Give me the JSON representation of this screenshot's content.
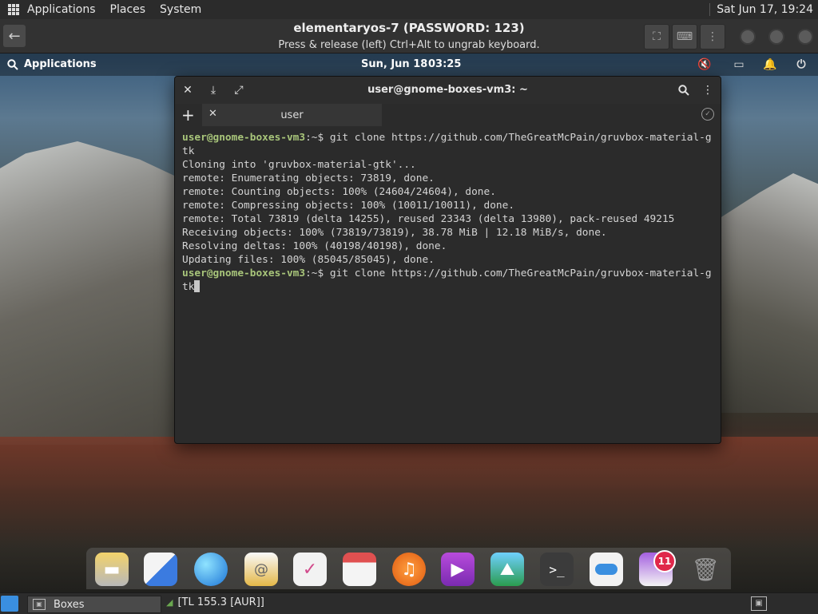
{
  "host": {
    "menu": [
      "Applications",
      "Places",
      "System"
    ],
    "clock": "Sat Jun 17, 19:24"
  },
  "boxes": {
    "title": "elementaryos-7 (PASSWORD: 123)",
    "subtitle": "Press & release (left) Ctrl+Alt to ungrab keyboard."
  },
  "os_panel": {
    "applications": "Applications",
    "date": "Sun, Jun 18",
    "time": "03:25"
  },
  "terminal": {
    "title": "user@gnome-boxes-vm3: ~",
    "tab_label": "user",
    "lines": [
      {
        "prompt": "user@gnome-boxes-vm3",
        "sep": ":~$ ",
        "text": "git clone https://github.com/TheGreatMcPain/gruvbox-material-gtk"
      },
      {
        "text": "Cloning into 'gruvbox-material-gtk'..."
      },
      {
        "text": "remote: Enumerating objects: 73819, done."
      },
      {
        "text": "remote: Counting objects: 100% (24604/24604), done."
      },
      {
        "text": "remote: Compressing objects: 100% (10011/10011), done."
      },
      {
        "text": "remote: Total 73819 (delta 14255), reused 23343 (delta 13980), pack-reused 49215"
      },
      {
        "text": "Receiving objects: 100% (73819/73819), 38.78 MiB | 12.18 MiB/s, done."
      },
      {
        "text": "Resolving deltas: 100% (40198/40198), done."
      },
      {
        "text": "Updating files: 100% (85045/85045), done."
      },
      {
        "prompt": "user@gnome-boxes-vm3",
        "sep": ":~$ ",
        "text": "git clone https://github.com/TheGreatMcPain/gruvbox-material-gtk",
        "cursor": true
      }
    ]
  },
  "dock": {
    "badge": "11",
    "icons": [
      "files-icon",
      "multitasking-icon",
      "web-browser-icon",
      "mail-icon",
      "tasks-icon",
      "calendar-icon",
      "music-icon",
      "videos-icon",
      "photos-icon",
      "terminal-icon",
      "system-settings-icon",
      "appcenter-icon",
      "trash-icon"
    ]
  },
  "taskbar": {
    "task1": "Boxes",
    "task2": "[TL 155.3 [AUR]]"
  },
  "colors": {
    "prompt": "#a8c57a",
    "terminal_bg": "#2b2b2b",
    "badge": "#e0284a"
  }
}
